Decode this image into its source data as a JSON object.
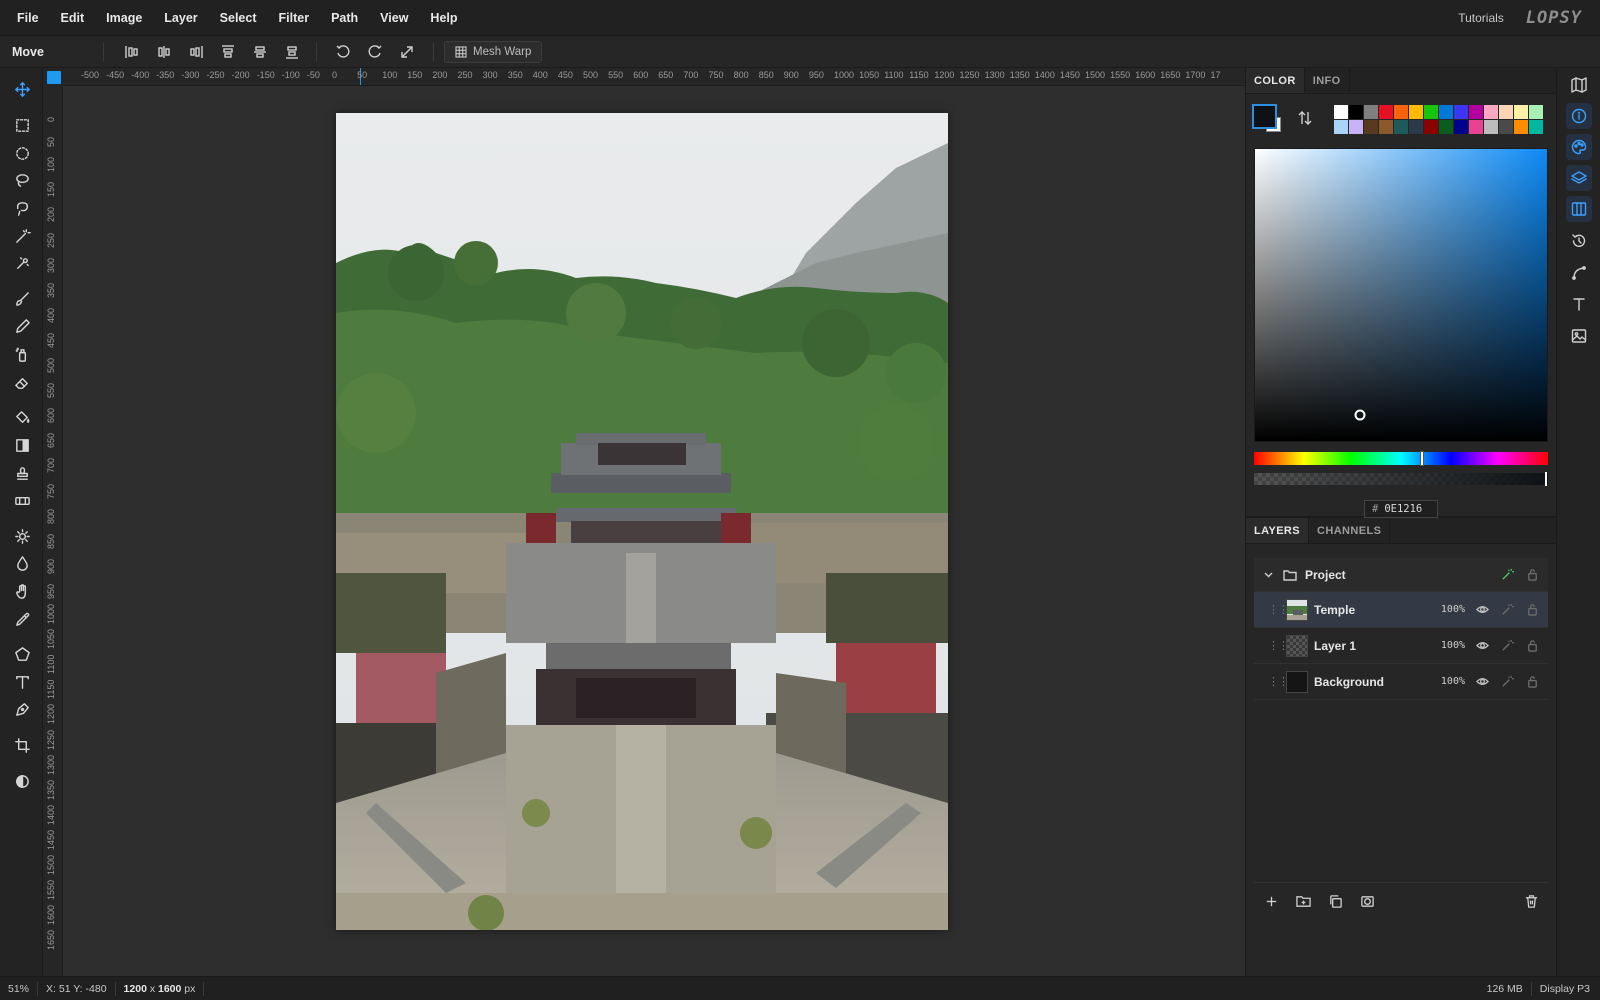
{
  "menu": {
    "items": [
      "File",
      "Edit",
      "Image",
      "Layer",
      "Select",
      "Filter",
      "Path",
      "View",
      "Help"
    ],
    "tutorials": "Tutorials",
    "logo": "LOPSY"
  },
  "options": {
    "tool_name": "Move",
    "mesh_warp_label": "Mesh Warp"
  },
  "rulers": {
    "h_ticks": [
      "-500",
      "-450",
      "-400",
      "-350",
      "-300",
      "-250",
      "-200",
      "-150",
      "-100",
      "-50",
      "0",
      "50",
      "100",
      "150",
      "200",
      "250",
      "300",
      "350",
      "400",
      "450",
      "500",
      "550",
      "600",
      "650",
      "700",
      "750",
      "800",
      "850",
      "900",
      "950",
      "1000",
      "1050",
      "1100",
      "1150",
      "1200",
      "1250",
      "1300",
      "1350",
      "1400",
      "1450",
      "1500",
      "1550",
      "1600",
      "1650",
      "1700",
      "17"
    ],
    "v_ticks": [
      "0",
      "50",
      "100",
      "150",
      "200",
      "250",
      "300",
      "350",
      "400",
      "450",
      "500",
      "550",
      "600",
      "650",
      "700",
      "750",
      "800",
      "850",
      "900",
      "950",
      "1000",
      "1050",
      "1100",
      "1150",
      "1200",
      "1250",
      "1300",
      "1350",
      "1400",
      "1450",
      "1500",
      "1550",
      "1600",
      "1650"
    ]
  },
  "color_panel": {
    "tabs": [
      "COLOR",
      "INFO"
    ],
    "foreground": "#0E1216",
    "background": "#FFFFFF",
    "hex_prefix": "#",
    "hex_value": "0E1216",
    "hue_fraction": 0.57,
    "swatches": [
      "#ffffff",
      "#000000",
      "#7f7f7f",
      "#e81123",
      "#f7630c",
      "#ffb900",
      "#16c60c",
      "#0078d7",
      "#3a36f2",
      "#b4009e",
      "#f9a8c4",
      "#fcd5b5",
      "#fff2a8",
      "#a8f0b4",
      "#a8d4f7",
      "#c9b3f7",
      "#5a3a1e",
      "#8a5a2a",
      "#1e5a5a",
      "#2a3a4a",
      "#8b0000",
      "#0b5d1e",
      "#00008b",
      "#e84393",
      "#bdbdbd",
      "#4a4a4a",
      "#ff8c00",
      "#00b8a0"
    ]
  },
  "layers_panel": {
    "tabs": [
      "LAYERS",
      "CHANNELS"
    ],
    "group_name": "Project",
    "layers": [
      {
        "name": "Temple",
        "opacity": "100%"
      },
      {
        "name": "Layer 1",
        "opacity": "100%"
      },
      {
        "name": "Background",
        "opacity": "100%"
      }
    ]
  },
  "status": {
    "zoom": "51%",
    "coords": "X: 51  Y: -480",
    "size_w": "1200",
    "size_x": "x",
    "size_h": "1600",
    "size_unit": "px",
    "memory": "126 MB",
    "display": "Display P3"
  }
}
